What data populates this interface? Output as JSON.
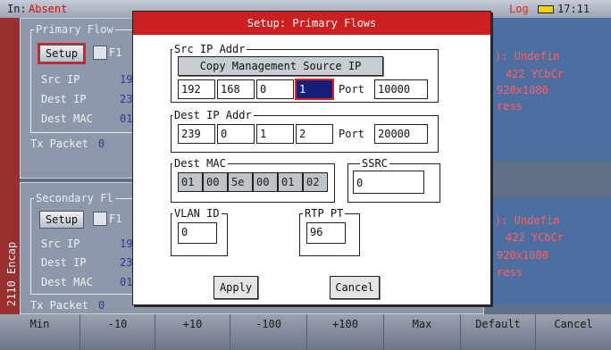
{
  "status": {
    "input_label": "In:",
    "input_value": "Absent",
    "log_label": "Log",
    "time": "17:11"
  },
  "side_label": "2110 Encap",
  "primary_panel": {
    "title": "Primary Flow",
    "setup_label": "Setup",
    "checkbox_label": "F1",
    "src_ip_label": "Src IP",
    "src_ip_partial": "19",
    "dest_ip_label": "Dest IP",
    "dest_ip_partial": "23",
    "dest_mac_label": "Dest MAC",
    "dest_mac_partial": "01",
    "tx_packet_label": "Tx Packet",
    "tx_packet_value": "0"
  },
  "secondary_panel": {
    "title": "Secondary Fl",
    "setup_label": "Setup",
    "checkbox_label": "F1",
    "src_ip_label": "Src IP",
    "src_ip_partial": "19",
    "dest_ip_label": "Dest IP",
    "dest_ip_partial": "23",
    "dest_mac_label": "Dest MAC",
    "dest_mac_partial": "01",
    "tx_packet_label": "Tx Packet",
    "tx_packet_value": "0"
  },
  "right_info": {
    "line1": "): Undefin",
    "line2": "422 YCbCr",
    "line3": "920x1080",
    "line4": "ress",
    "line5": "): Undefin",
    "line6": "422 YCbCr",
    "line7": "920x1080",
    "line8": "ress"
  },
  "dialog": {
    "title": "Setup: Primary Flows",
    "src_ip": {
      "legend": "Src IP Addr",
      "copy_button": "Copy Management Source IP",
      "octets": [
        "192",
        "168",
        "0",
        "1"
      ],
      "port_label": "Port",
      "port": "10000"
    },
    "dest_ip": {
      "legend": "Dest IP Addr",
      "octets": [
        "239",
        "0",
        "1",
        "2"
      ],
      "port_label": "Port",
      "port": "20000"
    },
    "dest_mac": {
      "legend": "Dest MAC",
      "bytes": [
        "01",
        "00",
        "5e",
        "00",
        "01",
        "02"
      ]
    },
    "ssrc": {
      "legend": "SSRC",
      "value": "0"
    },
    "vlan": {
      "legend": "VLAN ID",
      "value": "0"
    },
    "rtp_pt": {
      "legend": "RTP PT",
      "value": "96"
    },
    "apply_label": "Apply",
    "cancel_label": "Cancel"
  },
  "function_keys": [
    "Min",
    "-10",
    "+10",
    "-100",
    "+100",
    "Max",
    "Default",
    "Cancel"
  ],
  "colors": {
    "dialog_title_bg": "#cc1f1f",
    "active_field_bg": "#14207a",
    "alert_red": "#e02020"
  }
}
